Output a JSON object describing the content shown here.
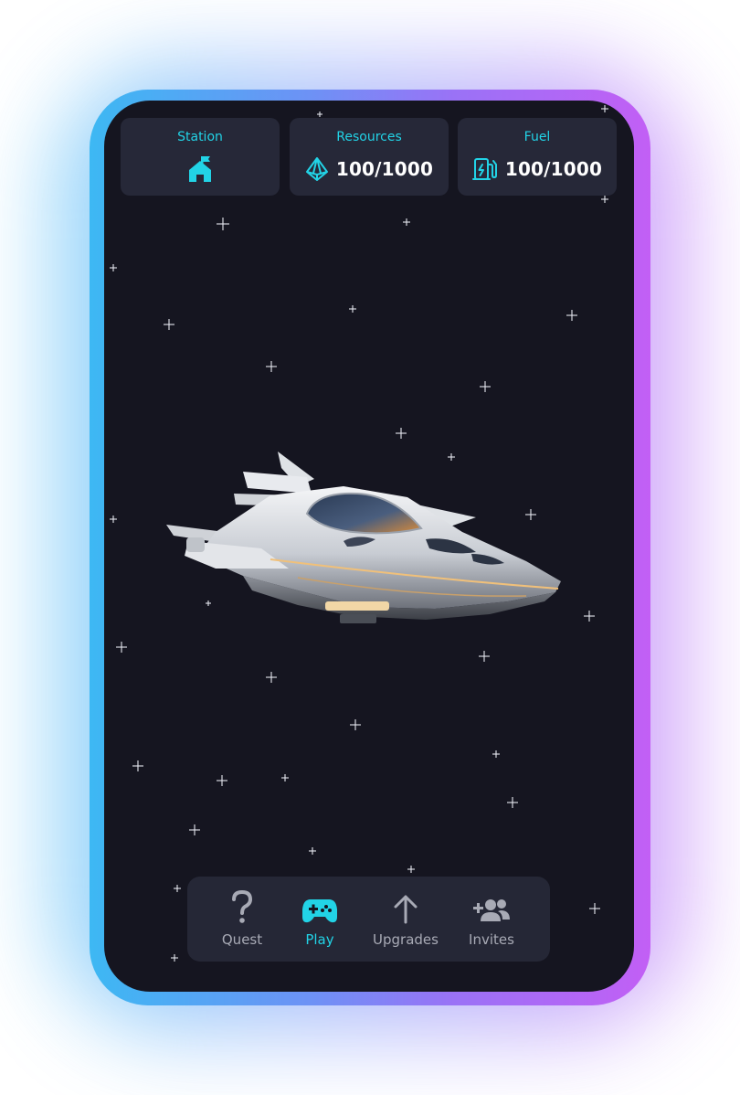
{
  "header": {
    "station": {
      "label": "Station",
      "icon": "station-house-flag-icon"
    },
    "resources": {
      "label": "Resources",
      "value": "100/1000",
      "icon": "crystal-icon"
    },
    "fuel": {
      "label": "Fuel",
      "value": "100/1000",
      "icon": "fuel-pump-icon"
    }
  },
  "scene": {
    "subject": "spaceship-icon"
  },
  "nav": {
    "items": [
      {
        "label": "Quest",
        "icon": "question-icon",
        "active": false
      },
      {
        "label": "Play",
        "icon": "gamepad-icon",
        "active": true
      },
      {
        "label": "Upgrades",
        "icon": "arrow-up-icon",
        "active": false
      },
      {
        "label": "Invites",
        "icon": "add-user-icon",
        "active": false
      }
    ]
  },
  "colors": {
    "accent": "#22d3e6",
    "background": "#151520",
    "card": "#262838",
    "frame_left": "#3db8f3",
    "frame_right": "#c25ff5",
    "inactive_text": "#a8aab5"
  }
}
